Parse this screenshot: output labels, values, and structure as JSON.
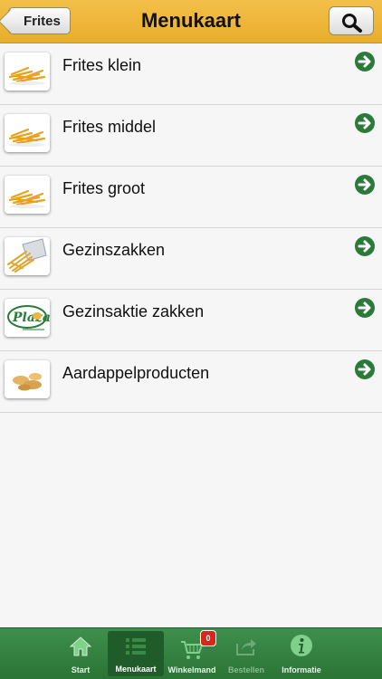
{
  "navbar": {
    "back_label": "Frites",
    "title": "Menukaart"
  },
  "menu": {
    "items": [
      {
        "label": "Frites klein",
        "icon": "fries-icon"
      },
      {
        "label": "Frites middel",
        "icon": "fries-icon"
      },
      {
        "label": "Frites groot",
        "icon": "fries-icon"
      },
      {
        "label": "Gezinszakken",
        "icon": "fries-bag-icon"
      },
      {
        "label": "Gezinsaktie zakken",
        "icon": "plaza-logo-icon"
      },
      {
        "label": "Aardappelproducten",
        "icon": "potato-products-icon"
      }
    ]
  },
  "tabbar": {
    "tabs": [
      {
        "label": "Start",
        "icon": "home-icon"
      },
      {
        "label": "Menukaart",
        "icon": "list-icon"
      },
      {
        "label": "Winkelmand",
        "icon": "cart-icon"
      },
      {
        "label": "Bestellen",
        "icon": "share-icon"
      },
      {
        "label": "Informatie",
        "icon": "info-icon"
      }
    ],
    "cart_count": "0"
  },
  "colors": {
    "navbar": "#ebb12f",
    "tabbar": "#2f7d3c",
    "arrow": "#2a7a3a",
    "badge": "#d42a1e"
  }
}
